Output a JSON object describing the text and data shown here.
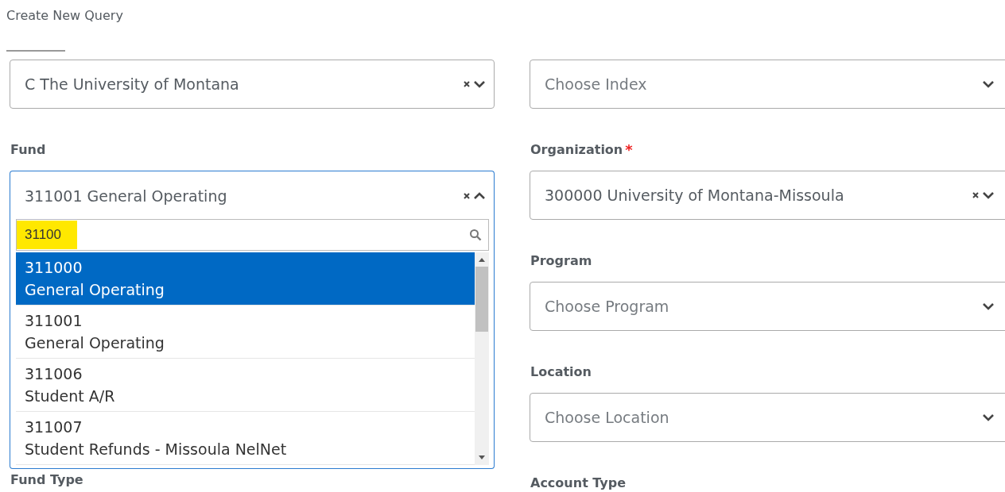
{
  "title": "Create New Query",
  "left": [
    {
      "value": "C The University of Montana",
      "clearable": true,
      "expanded": false
    },
    {
      "label": "Fund",
      "value": "311001 General Operating",
      "clearable": true,
      "expanded": true,
      "search": {
        "value": "31100",
        "highlighted": true
      },
      "options": [
        {
          "code": "311000",
          "name": "General Operating",
          "selected": true
        },
        {
          "code": "311001",
          "name": "General Operating",
          "selected": false
        },
        {
          "code": "311006",
          "name": "Student A/R",
          "selected": false
        },
        {
          "code": "311007",
          "name": "Student Refunds - Missoula NelNet",
          "selected": false
        }
      ]
    },
    {
      "label": "Fund Type"
    }
  ],
  "right": [
    {
      "placeholder": "Choose Index",
      "expanded": false
    },
    {
      "label": "Organization",
      "required_mark": "*",
      "value": "300000 University of Montana-Missoula",
      "clearable": true,
      "expanded": false
    },
    {
      "label": "Program",
      "placeholder": "Choose Program",
      "expanded": false
    },
    {
      "label": "Location",
      "placeholder": "Choose Location",
      "expanded": false
    },
    {
      "label": "Account Type"
    }
  ]
}
